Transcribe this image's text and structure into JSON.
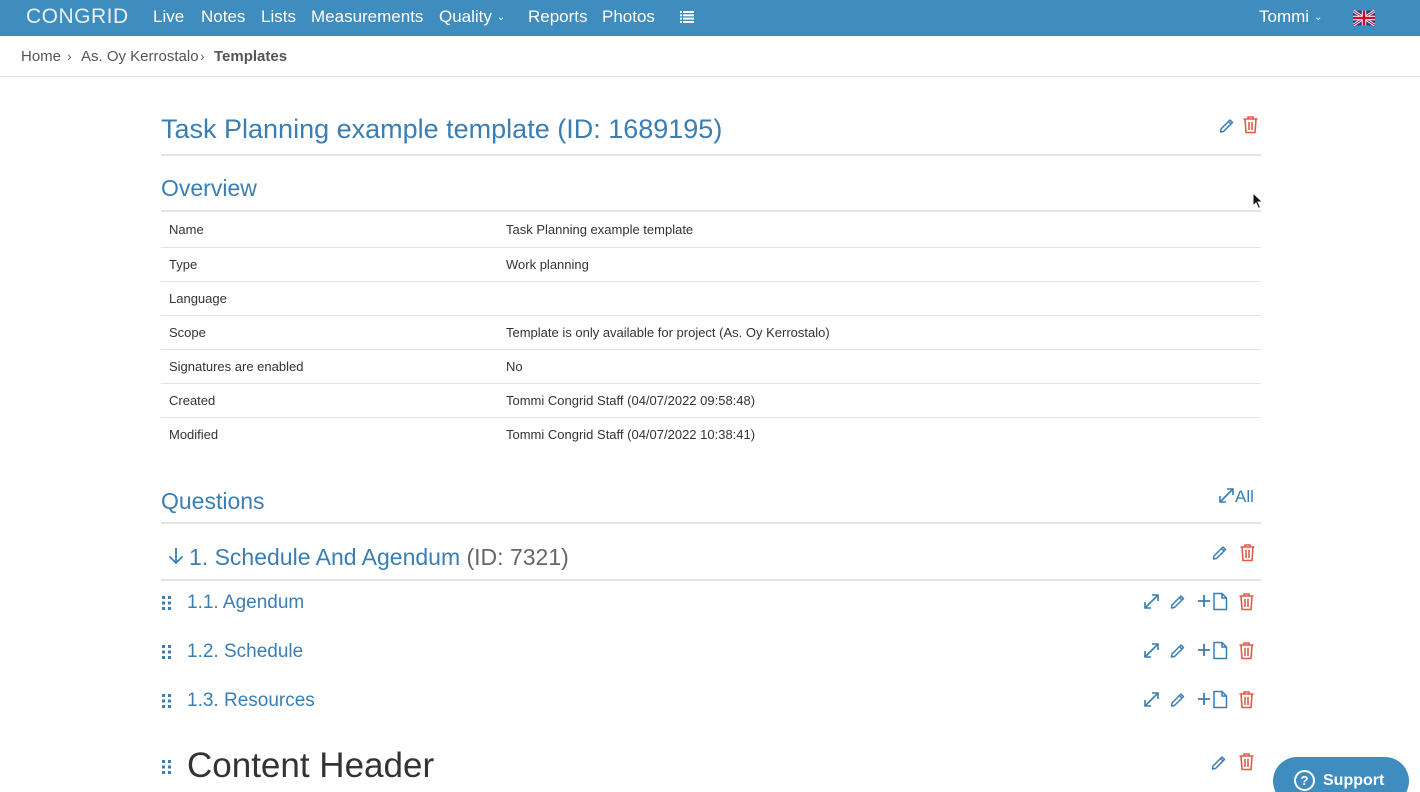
{
  "nav": {
    "logo": "CONGRID",
    "items": [
      "Live",
      "Notes",
      "Lists",
      "Measurements",
      "Quality",
      "Reports",
      "Photos"
    ],
    "user": "Tommi",
    "accent": "#3f8cbf"
  },
  "breadcrumb": {
    "items": [
      "Home",
      "As. Oy Kerrostalo"
    ],
    "current": "Templates"
  },
  "page": {
    "title": "Task Planning example template (ID: 1689195)"
  },
  "overview": {
    "heading": "Overview",
    "rows": [
      {
        "key": "Name",
        "value": "Task Planning example template"
      },
      {
        "key": "Type",
        "value": "Work planning"
      },
      {
        "key": "Language",
        "value": ""
      },
      {
        "key": "Scope",
        "value": "Template is only available for project (As. Oy Kerrostalo)"
      },
      {
        "key": "Signatures are enabled",
        "value": "No"
      },
      {
        "key": "Created",
        "value": "Tommi Congrid Staff (04/07/2022 09:58:48)"
      },
      {
        "key": "Modified",
        "value": "Tommi Congrid Staff (04/07/2022 10:38:41)"
      }
    ]
  },
  "questions": {
    "heading": "Questions",
    "expand_all_label": "All",
    "group": {
      "title": "1. Schedule And Agendum",
      "id_label": "(ID: 7321)"
    },
    "items": [
      {
        "label": "1.1. Agendum"
      },
      {
        "label": "1.2. Schedule"
      },
      {
        "label": "1.3. Resources"
      }
    ],
    "content_header": "Content Header"
  },
  "support": {
    "label": "Support",
    "icon_glyph": "?"
  },
  "icons": {
    "edit": "pencil-icon",
    "delete": "trash-icon",
    "expand": "expand-icon",
    "add_doc": "add-document-icon",
    "drag": "drag-handle-icon",
    "arrow_down": "arrow-down-icon"
  },
  "colors": {
    "link_blue": "#3a7eb4",
    "delete_red": "#e05a4a"
  }
}
